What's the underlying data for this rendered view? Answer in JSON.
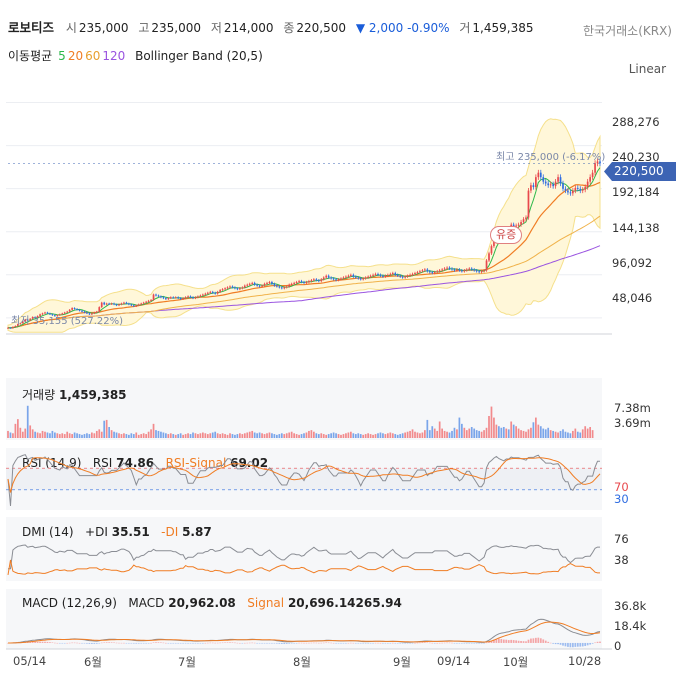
{
  "header": {
    "name": "로보티즈",
    "open_label": "시",
    "open": "235,000",
    "high_label": "고",
    "high": "235,000",
    "low_label": "저",
    "low": "214,000",
    "close_label": "종",
    "close": "220,500",
    "change_arrow": "▼",
    "change": "2,000",
    "change_pct": "-0.90%",
    "volume_label": "거",
    "volume": "1,459,385",
    "exchange": "한국거래소(KRX)"
  },
  "moving_average": {
    "label": "이동평균",
    "p5": "5",
    "p20": "20",
    "p60": "60",
    "p120": "120",
    "bb": "Bollinger Band (20,5)"
  },
  "scale_mode": "Linear",
  "colors": {
    "up": "#e8494d",
    "down": "#2f6de1",
    "ma5": "#2db84a",
    "ma20": "#f07d24",
    "ma60": "#f0b24a",
    "ma120": "#9a54e0",
    "bb_fill": "#fff7d9",
    "bb_line": "#f5e08c",
    "rsi": "#f07d24"
  },
  "chart_data": [
    {
      "type": "candlestick",
      "title": "",
      "y_ticks": [
        "288,276",
        "240,230",
        "192,184",
        "144,138",
        "96,092",
        "48,046"
      ],
      "ylim": [
        30000,
        300000
      ],
      "current_price_tag": "220,500",
      "max_annotation": "최고 235,000 (-6.17%)",
      "min_annotation": "최저 35,155 (527.22%)",
      "event_tag": "유증",
      "x_ticks": [
        "05/14",
        "6월",
        "7월",
        "8월",
        "9월",
        "09/14",
        "10월",
        "10/28"
      ],
      "close": [
        37000,
        36500,
        38000,
        39000,
        41000,
        42000,
        44000,
        46000,
        45000,
        47000,
        49000,
        48000,
        50000,
        52000,
        53000,
        54000,
        53000,
        52000,
        51000,
        50000,
        51000,
        52000,
        53000,
        54000,
        55000,
        57000,
        59000,
        58000,
        57000,
        56000,
        55000,
        54000,
        53000,
        52000,
        53000,
        54000,
        55000,
        60000,
        65000,
        63000,
        64000,
        63500,
        64000,
        63000,
        62000,
        63000,
        64000,
        65000,
        64000,
        63000,
        62000,
        61000,
        62000,
        63000,
        64000,
        65000,
        66000,
        67000,
        68000,
        74000,
        73000,
        72000,
        71000,
        70000,
        69000,
        70000,
        71000,
        70500,
        71000,
        70000,
        69000,
        70000,
        71000,
        72000,
        71000,
        70000,
        71000,
        72000,
        73000,
        74000,
        75000,
        76000,
        77000,
        76000,
        75000,
        77000,
        79000,
        80000,
        81000,
        82000,
        83000,
        82000,
        81000,
        80000,
        81000,
        82000,
        84000,
        85000,
        86000,
        87000,
        85000,
        84000,
        83000,
        84000,
        86000,
        87000,
        88000,
        86000,
        84000,
        83000,
        82000,
        81000,
        82000,
        83000,
        85000,
        86000,
        87000,
        88000,
        89000,
        88000,
        87000,
        88000,
        89000,
        90000,
        91000,
        90000,
        89000,
        91000,
        93000,
        95000,
        93000,
        92000,
        91000,
        90000,
        91000,
        92000,
        93000,
        94000,
        95000,
        96000,
        94000,
        93000,
        92000,
        91000,
        92000,
        93000,
        94000,
        95000,
        96000,
        97000,
        96000,
        95000,
        94000,
        95000,
        96000,
        97000,
        98000,
        96000,
        95000,
        94000,
        93000,
        94000,
        95000,
        96000,
        97000,
        98000,
        99000,
        100000,
        101000,
        102000,
        100000,
        99000,
        98000,
        99000,
        100000,
        101000,
        102000,
        103000,
        104000,
        103000,
        102000,
        101000,
        102000,
        101000,
        100000,
        101000,
        102000,
        103000,
        102000,
        101000,
        100000,
        99000,
        100000,
        101000,
        112000,
        120000,
        128000,
        135000,
        140000,
        138000,
        137000,
        136000,
        142000,
        141000,
        152000,
        150000,
        151000,
        152000,
        155000,
        158000,
        160000,
        190000,
        196000,
        194000,
        205000,
        210000,
        205000,
        200000,
        198000,
        196000,
        197000,
        195000,
        200000,
        205000,
        198000,
        192000,
        190000,
        188000,
        187000,
        190000,
        193000,
        192000,
        190000,
        191000,
        194000,
        200000,
        205000,
        210000,
        220500,
        222500,
        220500
      ],
      "series": [
        {
          "name": "이동평균 5"
        },
        {
          "name": "이동평균 20"
        },
        {
          "name": "이동평균 60"
        },
        {
          "name": "이동평균 120"
        },
        {
          "name": "Bollinger Band (20,5)"
        }
      ]
    },
    {
      "type": "bar",
      "title": "거래량",
      "value_label": "1,459,385",
      "y_ticks": [
        "7.38m",
        "3.69m"
      ],
      "values": [
        0.9,
        0.7,
        0.6,
        1.8,
        2.4,
        1.3,
        0.8,
        1.2,
        4.1,
        1.6,
        1.1,
        0.8,
        0.7,
        0.6,
        0.9,
        0.8,
        0.7,
        0.6,
        0.9,
        0.7,
        0.6,
        0.5,
        0.6,
        0.5,
        0.8,
        0.6,
        0.5,
        0.7,
        0.6,
        0.5,
        0.4,
        0.5,
        0.6,
        0.5,
        0.7,
        0.6,
        0.9,
        1.1,
        0.8,
        2.2,
        2.3,
        1.4,
        1.0,
        0.8,
        0.7,
        0.6,
        0.5,
        0.6,
        0.5,
        0.4,
        0.6,
        0.5,
        0.7,
        0.4,
        0.5,
        0.6,
        0.5,
        0.8,
        1.1,
        1.8,
        1.0,
        0.9,
        0.8,
        0.7,
        0.6,
        0.5,
        0.6,
        0.5,
        0.4,
        0.5,
        0.6,
        0.4,
        0.5,
        0.6,
        0.5,
        0.7,
        0.6,
        0.5,
        0.6,
        0.7,
        0.6,
        0.5,
        0.6,
        0.7,
        0.8,
        0.6,
        0.5,
        0.6,
        0.5,
        0.4,
        0.6,
        0.5,
        0.4,
        0.5,
        0.6,
        0.5,
        0.6,
        0.7,
        0.8,
        0.9,
        0.7,
        0.6,
        0.7,
        0.6,
        0.5,
        0.6,
        0.7,
        0.6,
        0.5,
        0.4,
        0.5,
        0.6,
        0.5,
        0.6,
        0.7,
        0.8,
        0.6,
        0.5,
        0.4,
        0.5,
        0.6,
        0.7,
        0.9,
        1.0,
        0.8,
        0.6,
        0.5,
        0.6,
        0.5,
        0.4,
        0.5,
        0.6,
        0.7,
        0.6,
        0.5,
        0.4,
        0.5,
        0.6,
        0.7,
        0.8,
        0.6,
        0.5,
        0.6,
        0.5,
        0.4,
        0.5,
        0.6,
        0.5,
        0.4,
        0.5,
        0.6,
        0.7,
        0.6,
        0.5,
        0.6,
        0.7,
        0.6,
        0.5,
        0.4,
        0.5,
        0.6,
        0.7,
        0.8,
        0.9,
        1.1,
        0.8,
        0.7,
        0.6,
        0.7,
        1.0,
        2.3,
        1.0,
        1.5,
        1.2,
        0.9,
        2.1,
        1.2,
        0.9,
        0.8,
        0.7,
        0.9,
        1.3,
        1.1,
        2.6,
        1.8,
        1.3,
        1.0,
        1.2,
        1.4,
        1.2,
        1.0,
        0.9,
        0.8,
        1.0,
        1.3,
        2.8,
        4.0,
        2.6,
        1.7,
        1.5,
        1.3,
        1.4,
        1.2,
        1.1,
        2.1,
        1.7,
        1.5,
        1.2,
        1.0,
        0.9,
        0.8,
        1.1,
        1.3,
        2.0,
        2.6,
        1.7,
        1.5,
        1.2,
        1.1,
        1.3,
        1.0,
        0.9,
        0.8,
        0.7,
        0.9,
        1.1,
        0.8,
        0.7,
        0.6,
        0.9,
        1.2,
        0.8,
        0.7,
        1.1,
        1.5,
        1.2,
        1.4,
        1.0
      ],
      "ylim": [
        0,
        7.38
      ]
    },
    {
      "type": "line",
      "title": "RSI (14,9)",
      "series": [
        {
          "name": "RSI",
          "last": "74.86"
        },
        {
          "name": "RSI-Signal",
          "last": "69.02"
        }
      ],
      "y_ticks": [
        "70",
        "30"
      ],
      "ylim": [
        0,
        100
      ]
    },
    {
      "type": "line",
      "title": "DMI (14)",
      "series": [
        {
          "name": "+DI",
          "last": "35.51"
        },
        {
          "name": "-DI",
          "last": "5.87"
        }
      ],
      "y_ticks": [
        "76",
        "38"
      ],
      "ylim": [
        0,
        90
      ]
    },
    {
      "type": "line",
      "title": "MACD (12,26,9)",
      "series": [
        {
          "name": "MACD",
          "last": "20,962.08"
        },
        {
          "name": "Signal",
          "last": "20,696.14265.94"
        }
      ],
      "y_ticks": [
        "36.8k",
        "18.4k",
        "0"
      ],
      "ylim": [
        -2000,
        40000
      ]
    }
  ]
}
